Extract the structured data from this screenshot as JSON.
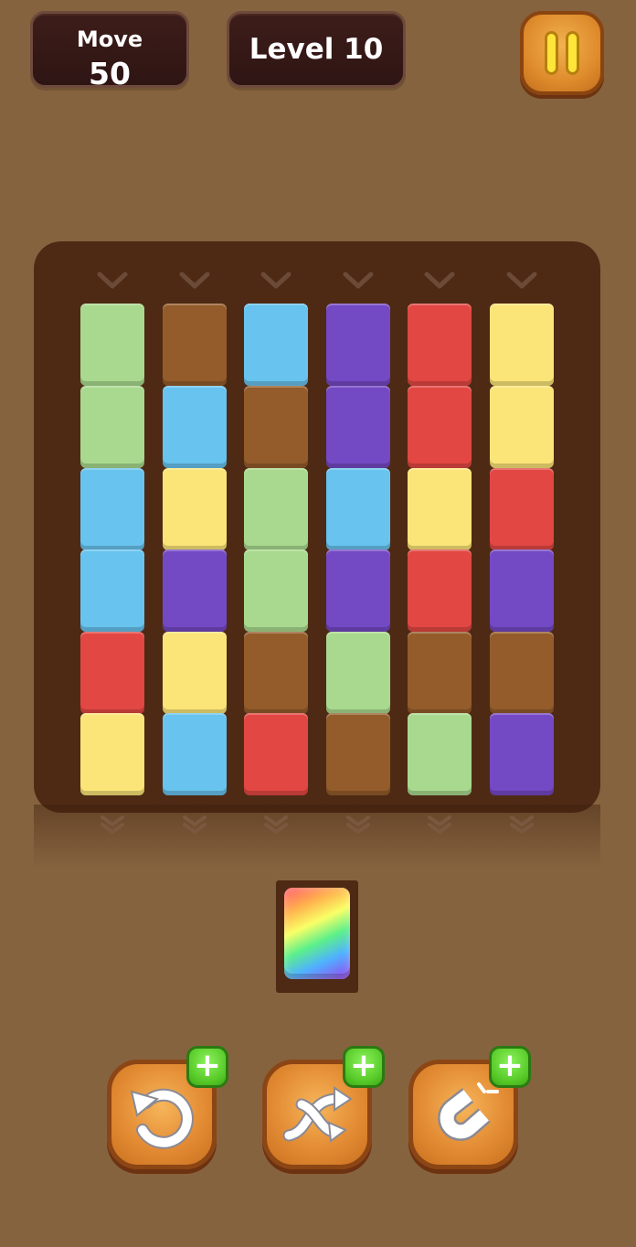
{
  "hud": {
    "move_label": "Move",
    "move_value": "50",
    "level_label": "Level 10",
    "pause_icon": "pause-icon"
  },
  "board": {
    "columns": [
      [
        "green",
        "green",
        "blue",
        "blue",
        "red",
        "yellow"
      ],
      [
        "brown",
        "blue",
        "yellow",
        "purple",
        "yellow",
        "blue"
      ],
      [
        "blue",
        "brown",
        "green",
        "green",
        "brown",
        "red"
      ],
      [
        "purple",
        "purple",
        "blue",
        "purple",
        "green",
        "brown"
      ],
      [
        "red",
        "red",
        "yellow",
        "red",
        "brown",
        "green"
      ],
      [
        "yellow",
        "yellow",
        "red",
        "purple",
        "brown",
        "purple"
      ]
    ],
    "colors": {
      "green": "#a9d98e",
      "brown": "#945c2b",
      "blue": "#68c3ee",
      "purple": "#7449c4",
      "red": "#e24743",
      "yellow": "#fbe578"
    },
    "drop_icon": "chevron-down-icon",
    "exit_icon": "double-chevron-down-icon"
  },
  "queue": {
    "tile": "rainbow"
  },
  "tools": [
    {
      "name": "undo",
      "icon": "undo-icon",
      "badge_icon": "plus-icon"
    },
    {
      "name": "shuffle",
      "icon": "shuffle-icon",
      "badge_icon": "plus-icon"
    },
    {
      "name": "magnet",
      "icon": "magnet-icon",
      "badge_icon": "plus-icon"
    }
  ]
}
